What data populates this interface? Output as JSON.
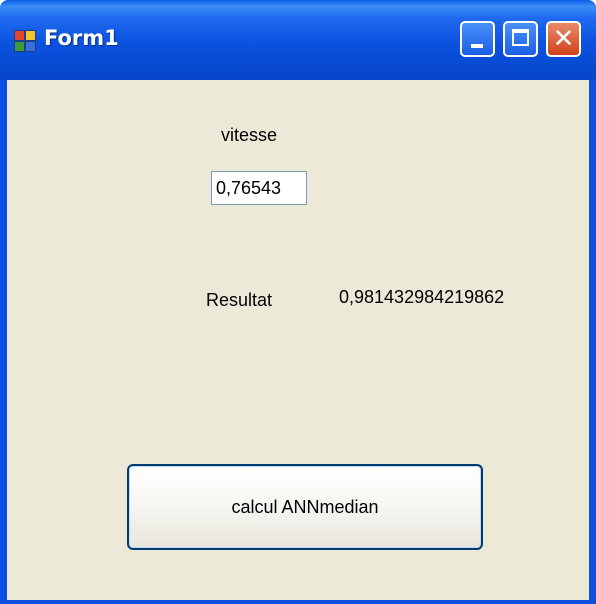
{
  "window": {
    "title": "Form1"
  },
  "form": {
    "vitesse_label": "vitesse",
    "vitesse_value": "0,76543",
    "resultat_label": "Resultat",
    "resultat_value": "0,981432984219862",
    "calc_button_label": "calcul ANNmedian"
  },
  "icons": {
    "app": "form-window-icon",
    "minimize": "minimize-icon",
    "maximize": "maximize-icon",
    "close": "close-icon"
  },
  "colors": {
    "titlebar": "#0a52df",
    "client_background": "#ece9d8",
    "close_button": "#d0411c"
  }
}
